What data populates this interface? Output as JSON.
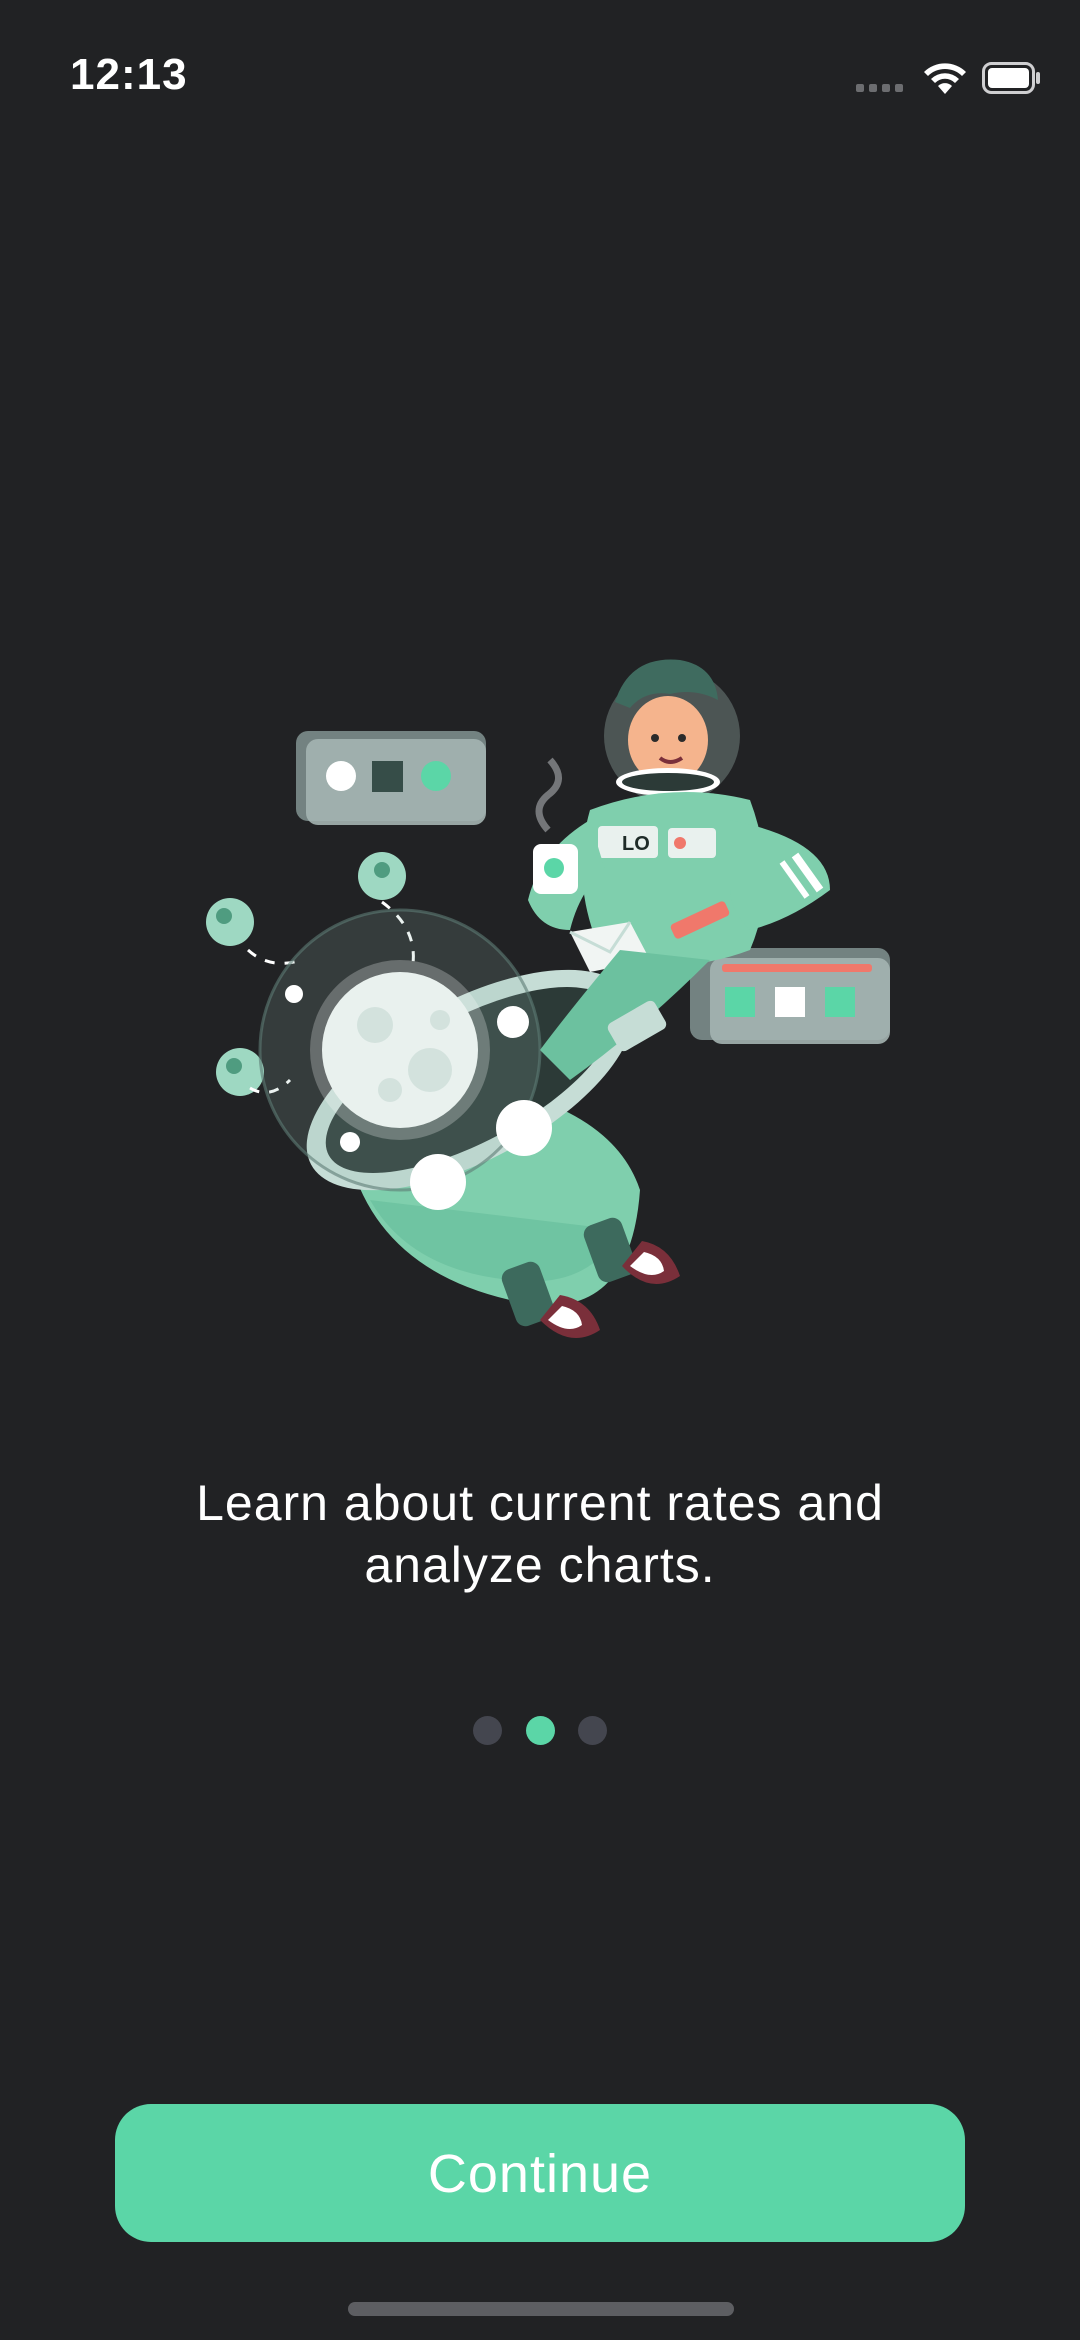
{
  "status_bar": {
    "time": "12:13",
    "signal_icon": "cellular-signal-icon",
    "wifi_icon": "wifi-icon",
    "battery_icon": "battery-icon"
  },
  "illustration": {
    "icon": "astronaut-spaceship-illustration",
    "badge_text": "LO"
  },
  "onboarding": {
    "line1": "Learn about current rates and",
    "line2": "analyze charts.",
    "page_count": 3,
    "current_page": 2
  },
  "colors": {
    "background": "#212224",
    "accent": "#5bd6a7",
    "dot_inactive": "#44464f"
  },
  "buttons": {
    "continue_label": "Continue"
  }
}
